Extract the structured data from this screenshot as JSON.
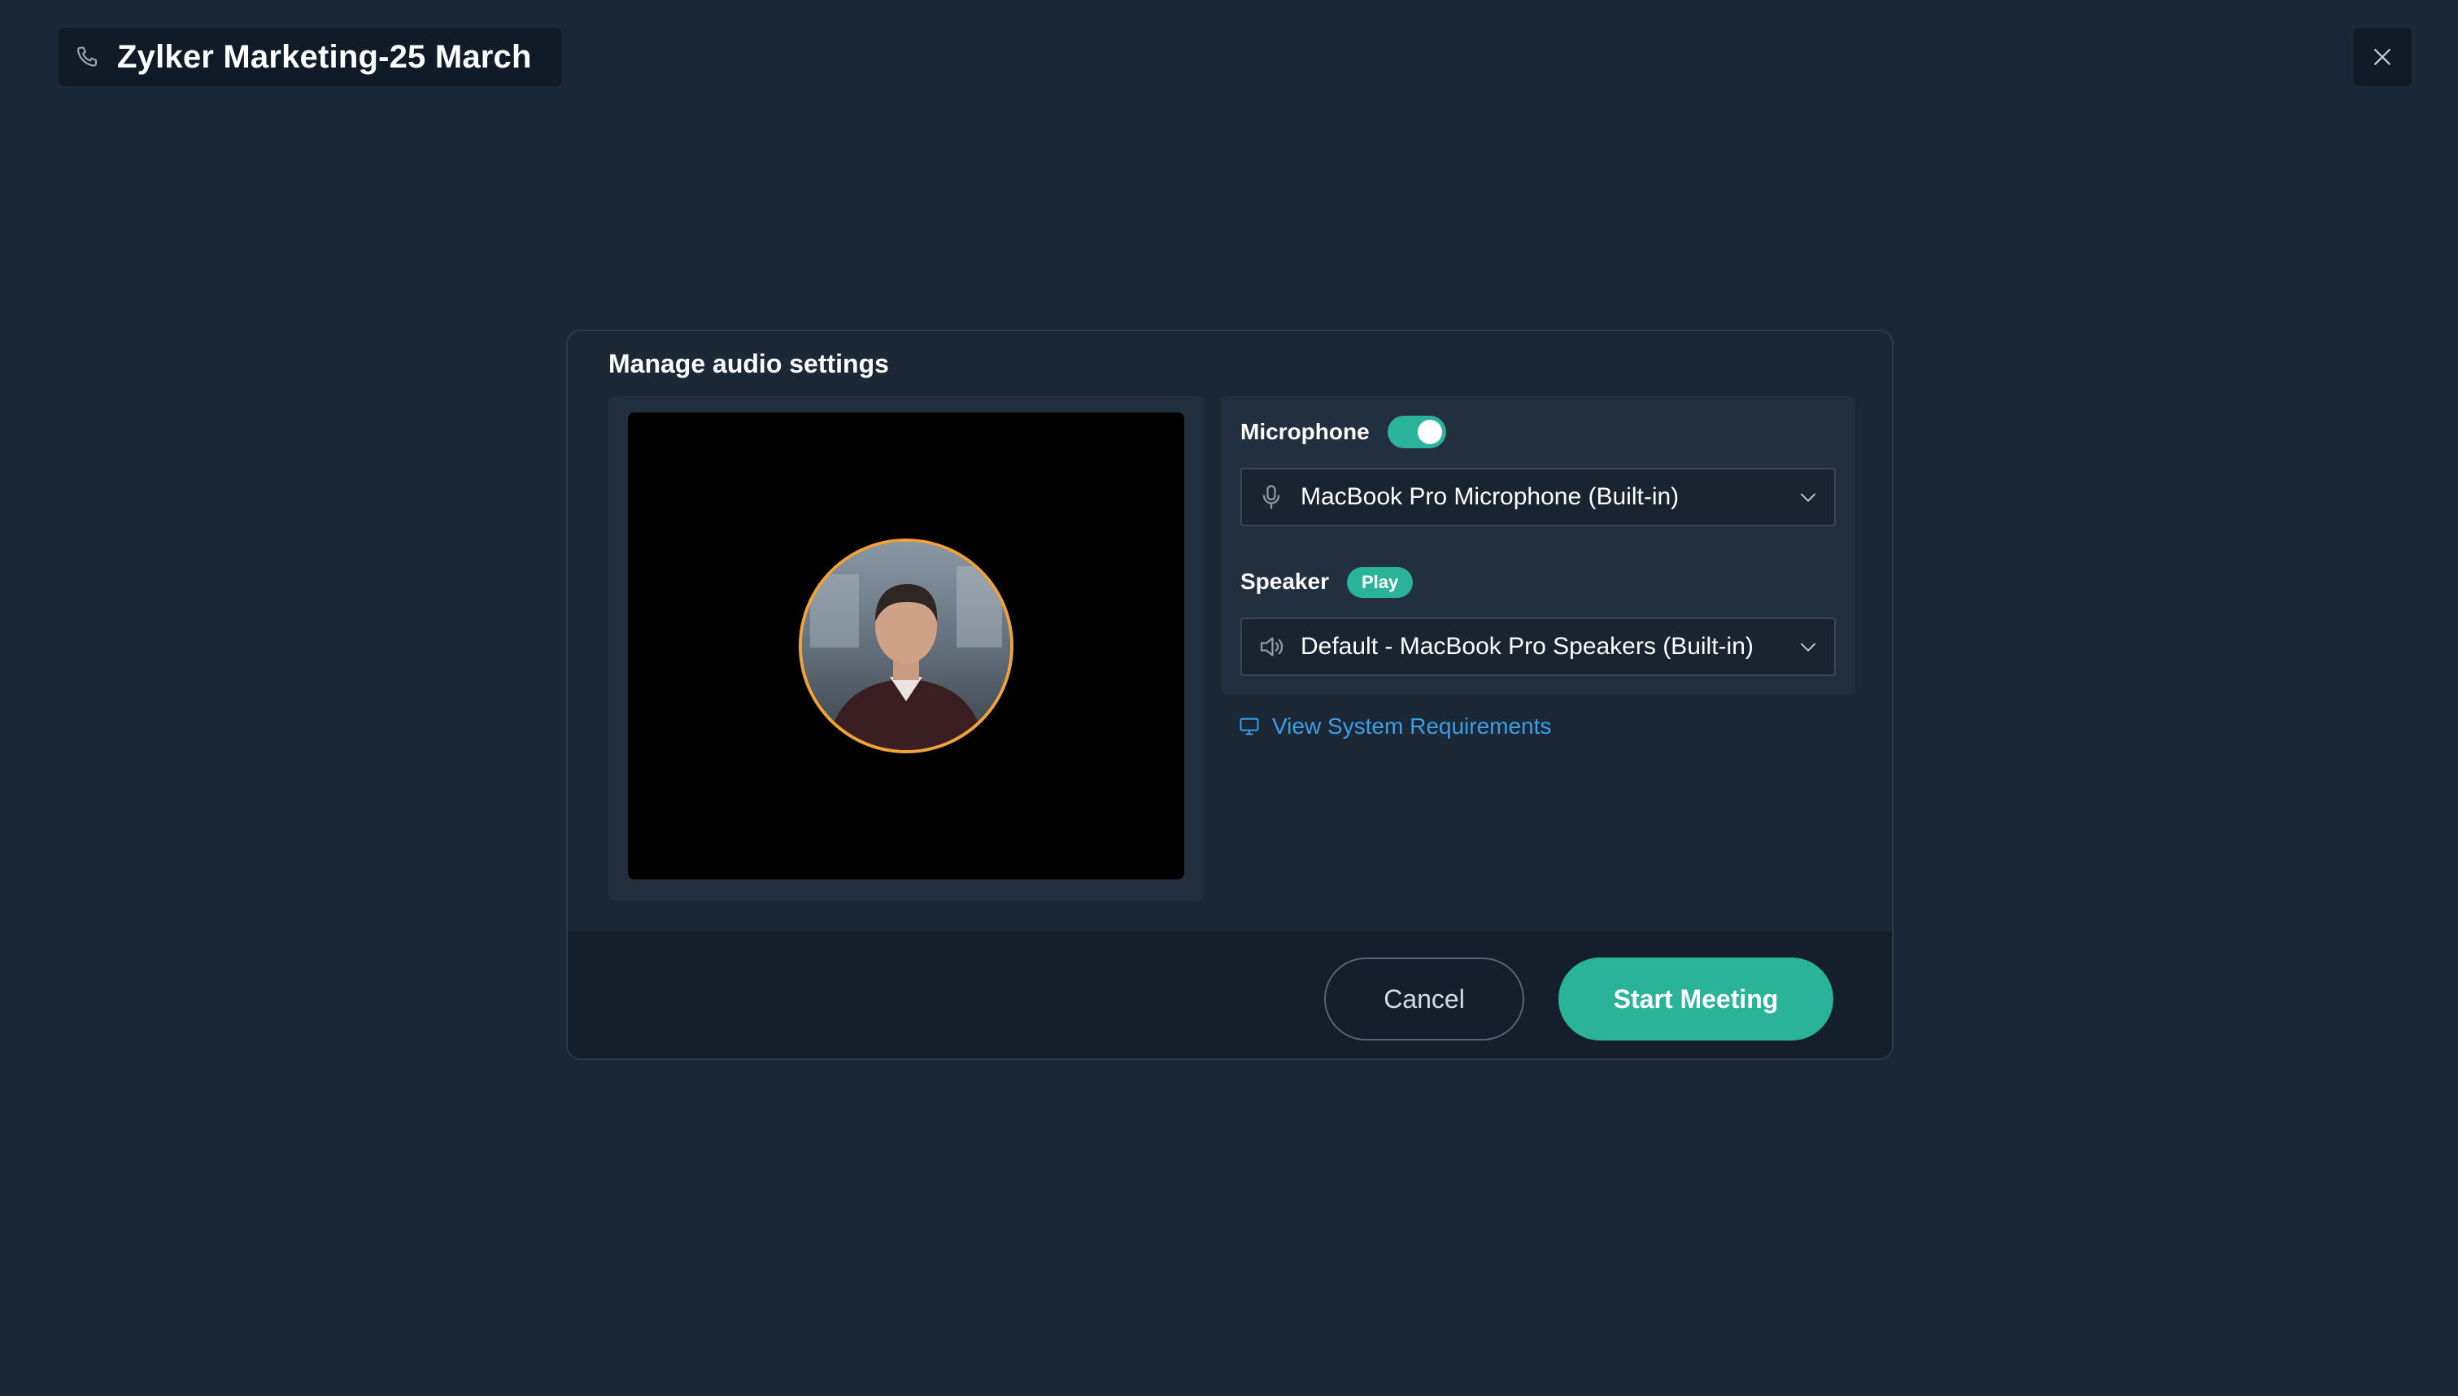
{
  "header": {
    "meeting_title": "Zylker Marketing-25 March",
    "title_icon": "phone-icon",
    "close_icon": "close-icon"
  },
  "dialog": {
    "title": "Manage audio settings",
    "preview": {
      "avatar_icon": "user-avatar"
    },
    "microphone": {
      "label": "Microphone",
      "enabled": true,
      "selected": "MacBook Pro Microphone (Built-in)",
      "icon": "microphone-icon"
    },
    "speaker": {
      "label": "Speaker",
      "play_label": "Play",
      "selected": "Default - MacBook Pro Speakers (Built-in)",
      "icon": "speaker-icon"
    },
    "system_requirements": {
      "label": "View System Requirements",
      "icon": "monitor-icon"
    },
    "actions": {
      "cancel_label": "Cancel",
      "start_label": "Start Meeting"
    }
  },
  "colors": {
    "background": "#1b2838",
    "accent": "#2bb39a",
    "link": "#3b9fe8",
    "avatar_ring": "#f0a23b"
  }
}
